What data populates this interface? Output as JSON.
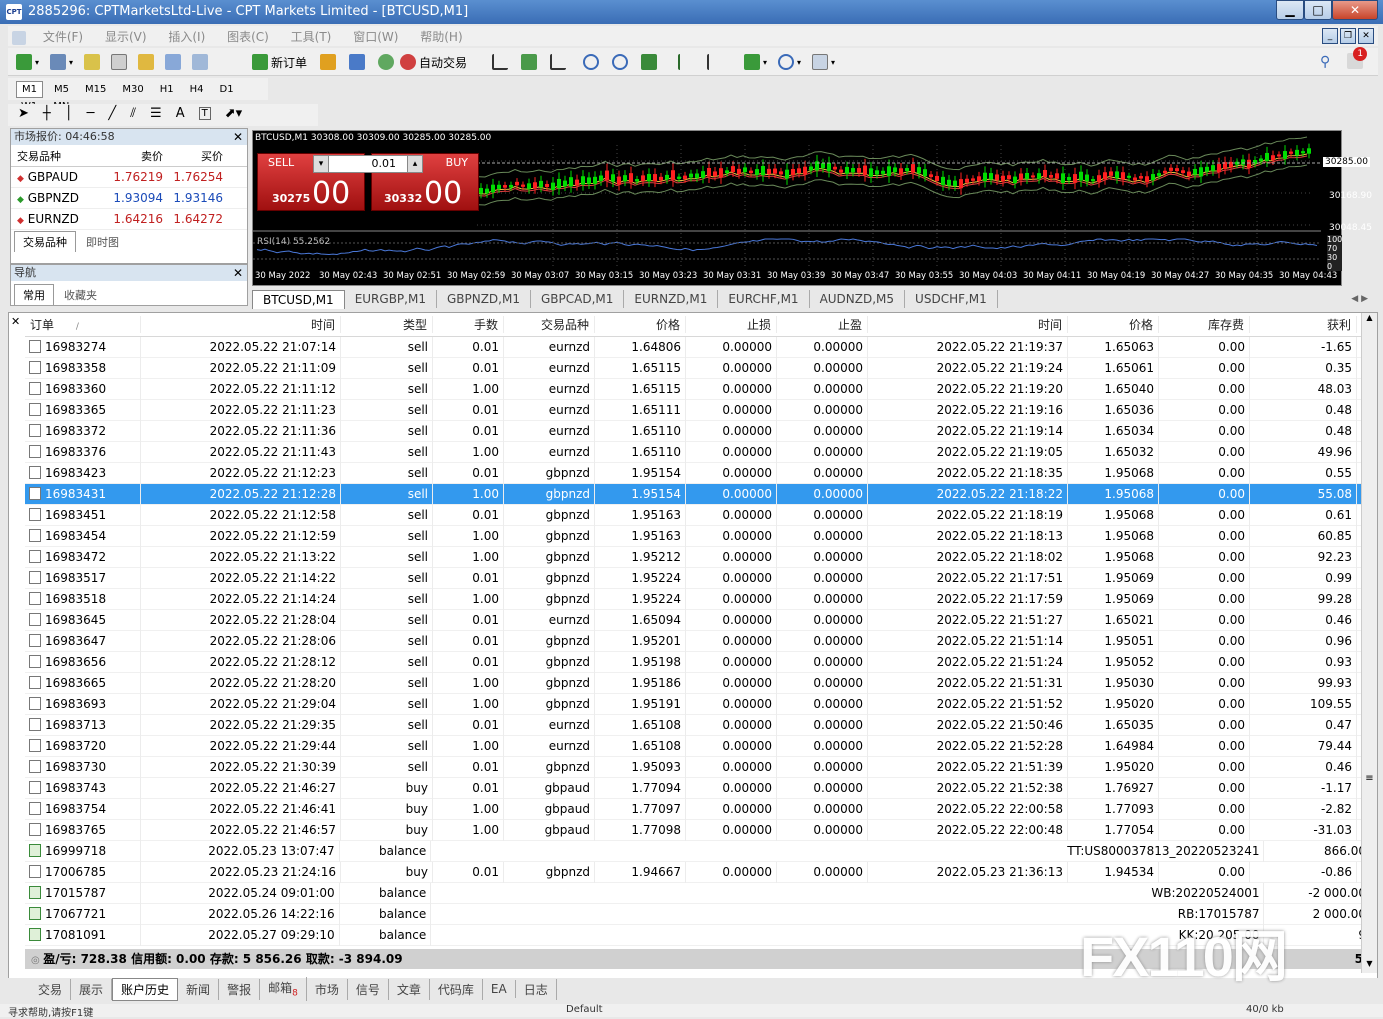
{
  "window": {
    "title": "2885296: CPTMarketsLtd-Live - CPT Markets Limited - [BTCUSD,M1]",
    "app_icon_text": "CPT",
    "minimize": "▁",
    "maximize": "□",
    "close": "✕"
  },
  "menu": [
    "文件(F)",
    "显示(V)",
    "插入(I)",
    "图表(C)",
    "工具(T)",
    "窗口(W)",
    "帮助(H)"
  ],
  "toolbar": {
    "new_order": "新订单",
    "auto_trade": "自动交易",
    "alerts_badge": "1"
  },
  "timeframes": [
    "M1",
    "M5",
    "M15",
    "M30",
    "H1",
    "H4",
    "D1",
    "W1",
    "MN"
  ],
  "active_timeframe": "M1",
  "drawing_tools": {
    "text_tool": "A",
    "label_tool": "T"
  },
  "market_watch": {
    "header": "市场报价: 04:46:58",
    "col_symbol": "交易品种",
    "col_bid": "卖价",
    "col_ask": "买价",
    "rows": [
      {
        "symbol": "GBPAUD",
        "bid": "1.76219",
        "ask": "1.76254",
        "dir": "down"
      },
      {
        "symbol": "GBPNZD",
        "bid": "1.93094",
        "ask": "1.93146",
        "dir": "up"
      },
      {
        "symbol": "EURNZD",
        "bid": "1.64216",
        "ask": "1.64272",
        "dir": "down"
      }
    ],
    "tabs": [
      "交易品种",
      "即时图"
    ]
  },
  "navigator": {
    "header": "导航",
    "tabs": [
      "常用",
      "收藏夹"
    ]
  },
  "chart": {
    "symbol_info": "BTCUSD,M1  30308.00 30309.00 30285.00 30285.00",
    "sell_label": "SELL",
    "buy_label": "BUY",
    "lot": "0.01",
    "sell_price_small": "30275",
    "sell_price_big": "00",
    "buy_price_small": "30332",
    "buy_price_big": "00",
    "price_labels": [
      "30285.00",
      "30168.90",
      "30048.45"
    ],
    "rsi_label": "RSI(14) 55.2562",
    "rsi_scale": [
      "100",
      "70",
      "30",
      "0"
    ],
    "time_labels": [
      "30 May 2022",
      "30 May 02:43",
      "30 May 02:51",
      "30 May 02:59",
      "30 May 03:07",
      "30 May 03:15",
      "30 May 03:23",
      "30 May 03:31",
      "30 May 03:39",
      "30 May 03:47",
      "30 May 03:55",
      "30 May 04:03",
      "30 May 04:11",
      "30 May 04:19",
      "30 May 04:27",
      "30 May 04:35",
      "30 May 04:43"
    ]
  },
  "chart_tabs": [
    "BTCUSD,M1",
    "EURGBP,M1",
    "GBPNZD,M1",
    "GBPCAD,M1",
    "EURNZD,M1",
    "EURCHF,M1",
    "AUDNZD,M5",
    "USDCHF,M1"
  ],
  "history": {
    "columns": [
      "订单",
      "时间",
      "类型",
      "手数",
      "交易品种",
      "价格",
      "止损",
      "止盈",
      "时间",
      "价格",
      "库存费",
      "获利"
    ],
    "sort_marker": "/",
    "rows": [
      [
        "16983274",
        "2022.05.22 21:07:14",
        "sell",
        "0.01",
        "eurnzd",
        "1.64806",
        "0.00000",
        "0.00000",
        "2022.05.22 21:19:37",
        "1.65063",
        "0.00",
        "-1.65"
      ],
      [
        "16983358",
        "2022.05.22 21:11:09",
        "sell",
        "0.01",
        "eurnzd",
        "1.65115",
        "0.00000",
        "0.00000",
        "2022.05.22 21:19:24",
        "1.65061",
        "0.00",
        "0.35"
      ],
      [
        "16983360",
        "2022.05.22 21:11:12",
        "sell",
        "1.00",
        "eurnzd",
        "1.65115",
        "0.00000",
        "0.00000",
        "2022.05.22 21:19:20",
        "1.65040",
        "0.00",
        "48.03"
      ],
      [
        "16983365",
        "2022.05.22 21:11:23",
        "sell",
        "0.01",
        "eurnzd",
        "1.65111",
        "0.00000",
        "0.00000",
        "2022.05.22 21:19:16",
        "1.65036",
        "0.00",
        "0.48"
      ],
      [
        "16983372",
        "2022.05.22 21:11:36",
        "sell",
        "0.01",
        "eurnzd",
        "1.65110",
        "0.00000",
        "0.00000",
        "2022.05.22 21:19:14",
        "1.65034",
        "0.00",
        "0.48"
      ],
      [
        "16983376",
        "2022.05.22 21:11:43",
        "sell",
        "1.00",
        "eurnzd",
        "1.65110",
        "0.00000",
        "0.00000",
        "2022.05.22 21:19:05",
        "1.65032",
        "0.00",
        "49.96"
      ],
      [
        "16983423",
        "2022.05.22 21:12:23",
        "sell",
        "0.01",
        "gbpnzd",
        "1.95154",
        "0.00000",
        "0.00000",
        "2022.05.22 21:18:35",
        "1.95068",
        "0.00",
        "0.55"
      ],
      [
        "16983431",
        "2022.05.22 21:12:28",
        "sell",
        "1.00",
        "gbpnzd",
        "1.95154",
        "0.00000",
        "0.00000",
        "2022.05.22 21:18:22",
        "1.95068",
        "0.00",
        "55.08"
      ],
      [
        "16983451",
        "2022.05.22 21:12:58",
        "sell",
        "0.01",
        "gbpnzd",
        "1.95163",
        "0.00000",
        "0.00000",
        "2022.05.22 21:18:19",
        "1.95068",
        "0.00",
        "0.61"
      ],
      [
        "16983454",
        "2022.05.22 21:12:59",
        "sell",
        "1.00",
        "gbpnzd",
        "1.95163",
        "0.00000",
        "0.00000",
        "2022.05.22 21:18:13",
        "1.95068",
        "0.00",
        "60.85"
      ],
      [
        "16983472",
        "2022.05.22 21:13:22",
        "sell",
        "1.00",
        "gbpnzd",
        "1.95212",
        "0.00000",
        "0.00000",
        "2022.05.22 21:18:02",
        "1.95068",
        "0.00",
        "92.23"
      ],
      [
        "16983517",
        "2022.05.22 21:14:22",
        "sell",
        "0.01",
        "gbpnzd",
        "1.95224",
        "0.00000",
        "0.00000",
        "2022.05.22 21:17:51",
        "1.95069",
        "0.00",
        "0.99"
      ],
      [
        "16983518",
        "2022.05.22 21:14:24",
        "sell",
        "1.00",
        "gbpnzd",
        "1.95224",
        "0.00000",
        "0.00000",
        "2022.05.22 21:17:59",
        "1.95069",
        "0.00",
        "99.28"
      ],
      [
        "16983645",
        "2022.05.22 21:28:04",
        "sell",
        "0.01",
        "eurnzd",
        "1.65094",
        "0.00000",
        "0.00000",
        "2022.05.22 21:51:27",
        "1.65021",
        "0.00",
        "0.46"
      ],
      [
        "16983647",
        "2022.05.22 21:28:06",
        "sell",
        "0.01",
        "gbpnzd",
        "1.95201",
        "0.00000",
        "0.00000",
        "2022.05.22 21:51:14",
        "1.95051",
        "0.00",
        "0.96"
      ],
      [
        "16983656",
        "2022.05.22 21:28:12",
        "sell",
        "0.01",
        "gbpnzd",
        "1.95198",
        "0.00000",
        "0.00000",
        "2022.05.22 21:51:24",
        "1.95052",
        "0.00",
        "0.93"
      ],
      [
        "16983665",
        "2022.05.22 21:28:20",
        "sell",
        "1.00",
        "gbpnzd",
        "1.95186",
        "0.00000",
        "0.00000",
        "2022.05.22 21:51:31",
        "1.95030",
        "0.00",
        "99.93"
      ],
      [
        "16983693",
        "2022.05.22 21:29:04",
        "sell",
        "1.00",
        "gbpnzd",
        "1.95191",
        "0.00000",
        "0.00000",
        "2022.05.22 21:51:52",
        "1.95020",
        "0.00",
        "109.55"
      ],
      [
        "16983713",
        "2022.05.22 21:29:35",
        "sell",
        "0.01",
        "eurnzd",
        "1.65108",
        "0.00000",
        "0.00000",
        "2022.05.22 21:50:46",
        "1.65035",
        "0.00",
        "0.47"
      ],
      [
        "16983720",
        "2022.05.22 21:29:44",
        "sell",
        "1.00",
        "eurnzd",
        "1.65108",
        "0.00000",
        "0.00000",
        "2022.05.22 21:52:28",
        "1.64984",
        "0.00",
        "79.44"
      ],
      [
        "16983730",
        "2022.05.22 21:30:39",
        "sell",
        "0.01",
        "gbpnzd",
        "1.95093",
        "0.00000",
        "0.00000",
        "2022.05.22 21:51:39",
        "1.95020",
        "0.00",
        "0.46"
      ],
      [
        "16983743",
        "2022.05.22 21:46:27",
        "buy",
        "0.01",
        "gbpaud",
        "1.77094",
        "0.00000",
        "0.00000",
        "2022.05.22 21:52:38",
        "1.76927",
        "0.00",
        "-1.17"
      ],
      [
        "16983754",
        "2022.05.22 21:46:41",
        "buy",
        "1.00",
        "gbpaud",
        "1.77097",
        "0.00000",
        "0.00000",
        "2022.05.22 22:00:58",
        "1.77093",
        "0.00",
        "-2.82"
      ],
      [
        "16983765",
        "2022.05.22 21:46:57",
        "buy",
        "1.00",
        "gbpaud",
        "1.77098",
        "0.00000",
        "0.00000",
        "2022.05.22 22:00:48",
        "1.77054",
        "0.00",
        "-31.03"
      ],
      [
        "16999718",
        "2022.05.23 13:07:47",
        "balance",
        "",
        "",
        "",
        "",
        "",
        "TT:US800037813_20220523241",
        "",
        "",
        "866.00"
      ],
      [
        "17006785",
        "2022.05.23 21:24:16",
        "buy",
        "0.01",
        "gbpnzd",
        "1.94667",
        "0.00000",
        "0.00000",
        "2022.05.23 21:36:13",
        "1.94534",
        "0.00",
        "-0.86"
      ],
      [
        "17015787",
        "2022.05.24 09:01:00",
        "balance",
        "",
        "",
        "",
        "",
        "",
        "WB:20220524001",
        "",
        "",
        "-2 000.00"
      ],
      [
        "17067721",
        "2022.05.26 14:22:16",
        "balance",
        "",
        "",
        "",
        "",
        "",
        "RB:17015787",
        "",
        "",
        "2 000.00"
      ],
      [
        "17081091",
        "2022.05.27 09:29:10",
        "balance",
        "",
        "",
        "",
        "",
        "",
        "KK:20 205 00",
        "",
        "",
        "9"
      ]
    ],
    "selected_index": 7,
    "summary": "盈/亏: 728.38  信用额: 0.00  存款: 5 856.26  取款: -3 894.09",
    "summary_tail": "5"
  },
  "bottom_tabs": [
    "交易",
    "展示",
    "账户历史",
    "新闻",
    "警报",
    "邮箱",
    "市场",
    "信号",
    "文章",
    "代码库",
    "EA",
    "日志"
  ],
  "active_bottom_tab": "账户历史",
  "mail_badge": "8",
  "status": {
    "help": "寻求帮助,请按F1键",
    "profile": "Default",
    "traffic": "40/0 kb"
  },
  "watermark": "FX110网",
  "colors": {
    "titlebar": "#3a6db5",
    "selected_row": "#3399ee",
    "sell": "#d02020",
    "buy": "#d02020",
    "bull_candle": "#00cc00",
    "bear_candle": "#ff2020"
  }
}
